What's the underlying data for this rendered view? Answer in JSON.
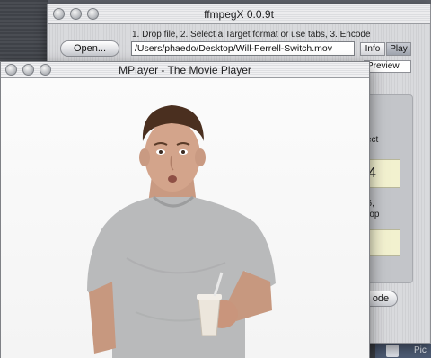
{
  "desktop": {
    "dock_label": "Pic"
  },
  "ffmpegx": {
    "title": "ffmpegX 0.0.9t",
    "instructions": "1. Drop file, 2. Select a Target format or use tabs, 3. Encode",
    "open_label": "Open...",
    "file_path": "/Users/phaedo/Desktop/Will-Ferrell-Switch.mov",
    "info_label": "Info",
    "play_label": "Play",
    "preview_label": "Preview",
    "panel": {
      "select_partial": "ect",
      "value_partial": "4",
      "line1_partial": "56,",
      "line2_partial": "crop"
    },
    "encode_label": "ode"
  },
  "mplayer": {
    "title": "MPlayer - The Movie Player"
  },
  "colors": {
    "aqua_button": "#e4e5e8",
    "field_box": "#f2f1cf",
    "window_chrome": "#dcdde0"
  }
}
